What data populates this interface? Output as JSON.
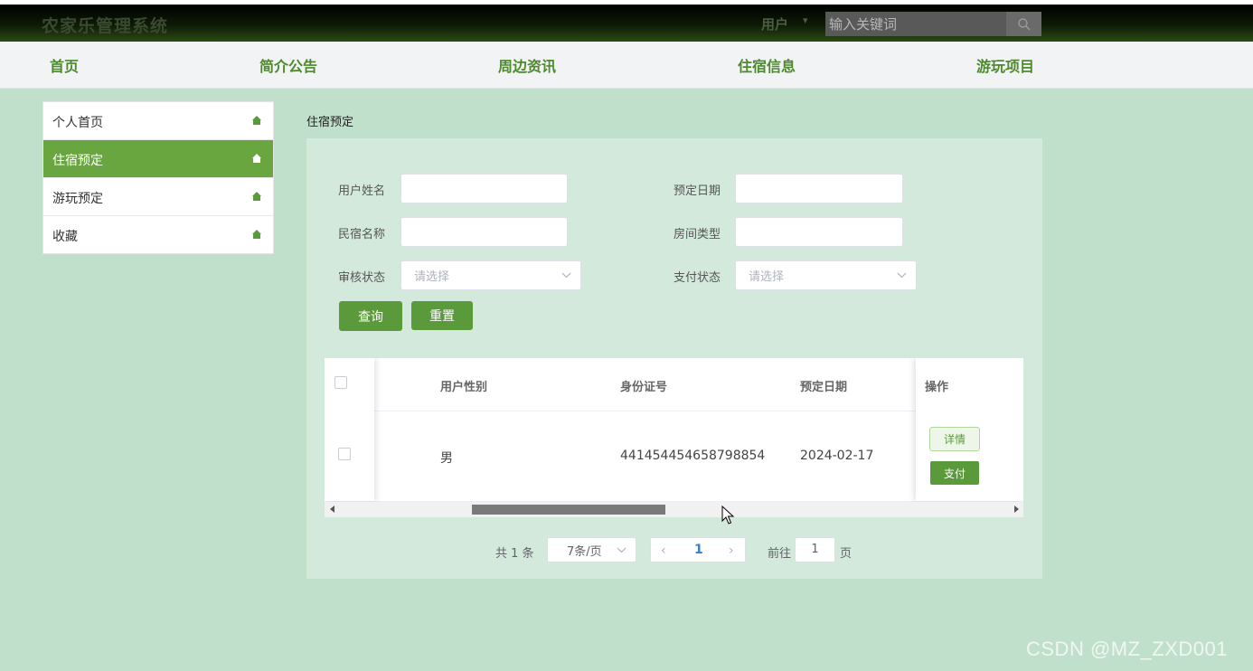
{
  "app": {
    "title": "农家乐管理系统",
    "user_menu_label": "用户",
    "search_placeholder": "输入关键词"
  },
  "nav": {
    "items": [
      {
        "label": "首页"
      },
      {
        "label": "简介公告"
      },
      {
        "label": "周边资讯"
      },
      {
        "label": "住宿信息"
      },
      {
        "label": "游玩项目"
      }
    ]
  },
  "sidebar": {
    "items": [
      {
        "label": "个人首页",
        "icon": "home-icon",
        "active": false
      },
      {
        "label": "住宿预定",
        "icon": "home-icon",
        "active": true
      },
      {
        "label": "游玩预定",
        "icon": "home-icon",
        "active": false
      },
      {
        "label": "收藏",
        "icon": "home-icon",
        "active": false
      }
    ]
  },
  "breadcrumb": "住宿预定",
  "filters": {
    "user_name": {
      "label": "用户姓名",
      "value": ""
    },
    "booking_date": {
      "label": "预定日期",
      "value": ""
    },
    "homestay_name": {
      "label": "民宿名称",
      "value": ""
    },
    "room_type": {
      "label": "房间类型",
      "value": ""
    },
    "review_status": {
      "label": "审核状态",
      "placeholder": "请选择"
    },
    "payment_status": {
      "label": "支付状态",
      "placeholder": "请选择"
    },
    "query_button": "查询",
    "reset_button": "重置"
  },
  "table": {
    "columns": [
      "用户性别",
      "身份证号",
      "预定日期",
      "操作"
    ],
    "rows": [
      {
        "gender": "男",
        "id_number": "441454454658798854",
        "booking_date": "2024-02-17",
        "actions": [
          "详情",
          "支付"
        ]
      }
    ]
  },
  "pagination": {
    "total_text": "共 1 条",
    "page_size": "7条/页",
    "current_page": "1",
    "goto_label": "前往",
    "goto_value": "1",
    "page_unit": "页",
    "prev_symbol": "‹",
    "next_symbol": "›"
  },
  "watermark": "CSDN @MZ_ZXD001",
  "colors": {
    "accent": "#5b9a3a",
    "active_sidebar": "#6aa640",
    "page_bg": "#c0e0cb",
    "panel_bg": "#d3e9dc",
    "nav_text": "#4c8a2c"
  }
}
